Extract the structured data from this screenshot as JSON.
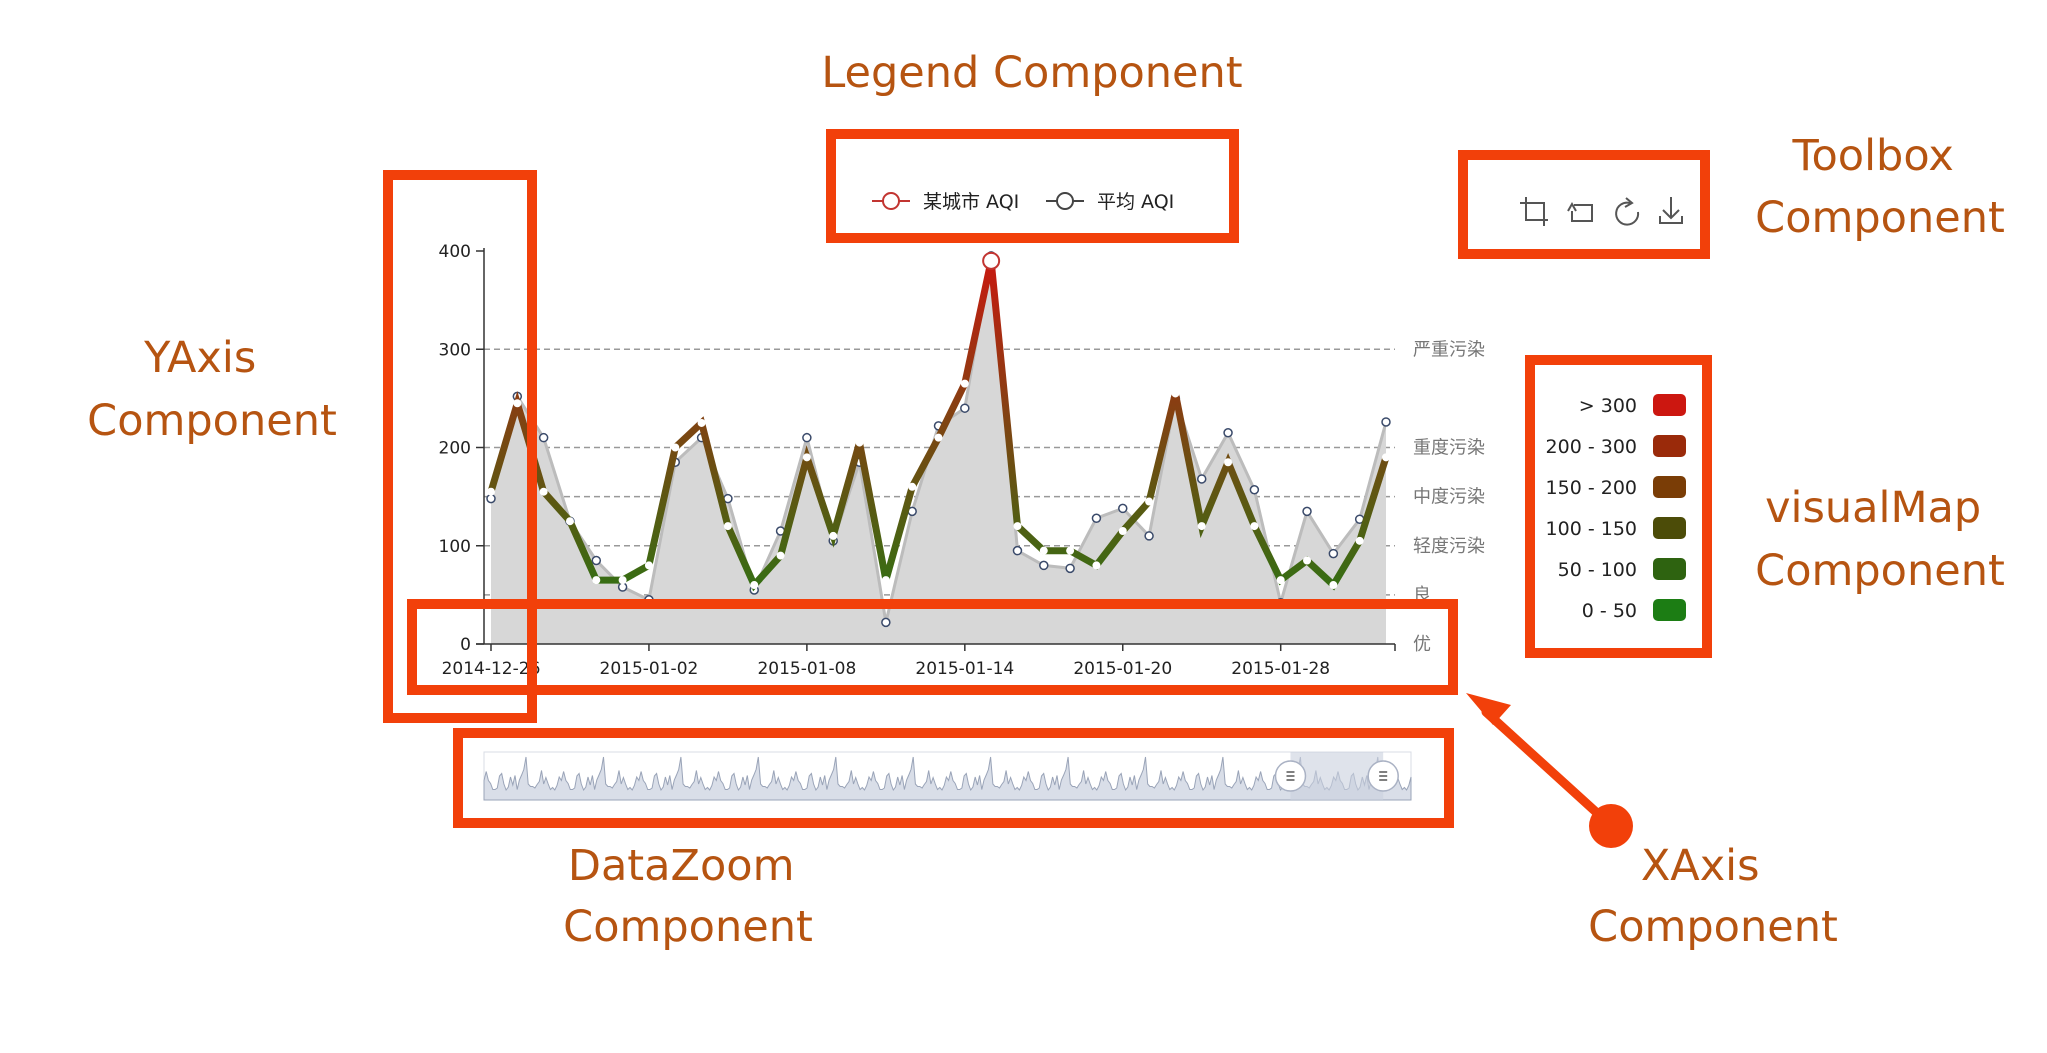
{
  "annotations": {
    "legend": [
      "Legend Component"
    ],
    "toolbox": [
      "Toolbox",
      "Component"
    ],
    "yaxis": [
      "YAxis",
      "Component"
    ],
    "visualmap": [
      "visualMap",
      "Component"
    ],
    "datazoom": [
      "DataZoom",
      "Component"
    ],
    "xaxis": [
      "XAxis",
      "Component"
    ]
  },
  "colors": {
    "annotation_box": "#f2400a",
    "annotation_text": "#b65411",
    "legend_city_marker": "#c23531",
    "legend_avg_marker": "#444444",
    "avg_area_fill": "#d7d7d7",
    "avg_line": "#bcbcbc",
    "band_line": "#999999",
    "datazoom_fill": "#d9dee8",
    "datazoom_selected": "#c9d0de"
  },
  "toolbox": {
    "icons": [
      "data-zoom-icon",
      "data-zoom-reset-icon",
      "restore-icon",
      "save-image-icon"
    ]
  },
  "chart_data": {
    "type": "line",
    "legend": [
      {
        "name": "某城市 AQI",
        "marker": "hollow-circle",
        "color": "#c23531"
      },
      {
        "name": "平均 AQI",
        "marker": "hollow-circle",
        "color": "#444444"
      }
    ],
    "xlabels": [
      "2014-12-26",
      "2015-01-02",
      "2015-01-08",
      "2015-01-14",
      "2015-01-20",
      "2015-01-28"
    ],
    "ylim": [
      0,
      400
    ],
    "yticks": [
      0,
      100,
      200,
      300,
      400
    ],
    "bands": [
      {
        "label": "严重污染",
        "value": 300
      },
      {
        "label": "重度污染",
        "value": 200
      },
      {
        "label": "中度污染",
        "value": 150
      },
      {
        "label": "轻度污染",
        "value": 100
      },
      {
        "label": "良",
        "value": 50
      },
      {
        "label": "优",
        "value": 0
      }
    ],
    "series": [
      {
        "name": "某城市 AQI",
        "values": [
          155,
          245,
          155,
          125,
          65,
          65,
          80,
          200,
          225,
          120,
          60,
          90,
          190,
          110,
          205,
          65,
          160,
          210,
          265,
          390,
          120,
          95,
          95,
          80,
          115,
          145,
          255,
          120,
          185,
          120,
          65,
          85,
          60,
          105,
          190
        ]
      },
      {
        "name": "平均 AQI",
        "values": [
          148,
          252,
          210,
          125,
          85,
          58,
          45,
          185,
          210,
          148,
          55,
          115,
          210,
          105,
          185,
          22,
          135,
          222,
          240,
          395,
          95,
          80,
          77,
          128,
          138,
          110,
          250,
          168,
          215,
          157,
          42,
          135,
          92,
          127,
          226
        ]
      }
    ]
  },
  "visualmap": {
    "pieces": [
      {
        "label": "> 300",
        "color": "#cc1710"
      },
      {
        "label": "200 - 300",
        "color": "#9a2a0a"
      },
      {
        "label": "150 - 200",
        "color": "#7a3d06"
      },
      {
        "label": "100 - 150",
        "color": "#4c4c08"
      },
      {
        "label": "50 - 100",
        "color": "#2e6310"
      },
      {
        "label": "0 - 50",
        "color": "#1c7d14"
      }
    ]
  },
  "datazoom": {
    "start": 0.87,
    "end": 0.97
  }
}
